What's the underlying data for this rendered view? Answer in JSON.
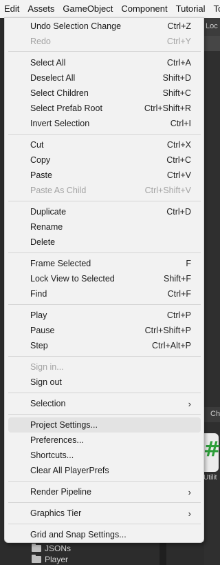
{
  "menubar": {
    "items": [
      "Edit",
      "Assets",
      "GameObject",
      "Component",
      "Tutorial",
      "Too"
    ]
  },
  "background": {
    "lock_text": "Loc",
    "ch_text": "Ch",
    "asset_label": "Utilit",
    "folders": [
      "JSONs",
      "Player"
    ]
  },
  "menu": {
    "undo": {
      "label": "Undo Selection Change",
      "shortcut": "Ctrl+Z"
    },
    "redo": {
      "label": "Redo",
      "shortcut": "Ctrl+Y"
    },
    "select_all": {
      "label": "Select All",
      "shortcut": "Ctrl+A"
    },
    "deselect_all": {
      "label": "Deselect All",
      "shortcut": "Shift+D"
    },
    "select_children": {
      "label": "Select Children",
      "shortcut": "Shift+C"
    },
    "select_prefab_root": {
      "label": "Select Prefab Root",
      "shortcut": "Ctrl+Shift+R"
    },
    "invert_selection": {
      "label": "Invert Selection",
      "shortcut": "Ctrl+I"
    },
    "cut": {
      "label": "Cut",
      "shortcut": "Ctrl+X"
    },
    "copy": {
      "label": "Copy",
      "shortcut": "Ctrl+C"
    },
    "paste": {
      "label": "Paste",
      "shortcut": "Ctrl+V"
    },
    "paste_as_child": {
      "label": "Paste As Child",
      "shortcut": "Ctrl+Shift+V"
    },
    "duplicate": {
      "label": "Duplicate",
      "shortcut": "Ctrl+D"
    },
    "rename": {
      "label": "Rename"
    },
    "delete": {
      "label": "Delete"
    },
    "frame_selected": {
      "label": "Frame Selected",
      "shortcut": "F"
    },
    "lock_view": {
      "label": "Lock View to Selected",
      "shortcut": "Shift+F"
    },
    "find": {
      "label": "Find",
      "shortcut": "Ctrl+F"
    },
    "play": {
      "label": "Play",
      "shortcut": "Ctrl+P"
    },
    "pause": {
      "label": "Pause",
      "shortcut": "Ctrl+Shift+P"
    },
    "step": {
      "label": "Step",
      "shortcut": "Ctrl+Alt+P"
    },
    "sign_in": {
      "label": "Sign in..."
    },
    "sign_out": {
      "label": "Sign out"
    },
    "selection": {
      "label": "Selection"
    },
    "project_settings": {
      "label": "Project Settings..."
    },
    "preferences": {
      "label": "Preferences..."
    },
    "shortcuts": {
      "label": "Shortcuts..."
    },
    "clear_playerprefs": {
      "label": "Clear All PlayerPrefs"
    },
    "render_pipeline": {
      "label": "Render Pipeline"
    },
    "graphics_tier": {
      "label": "Graphics Tier"
    },
    "grid_snap": {
      "label": "Grid and Snap Settings..."
    }
  }
}
